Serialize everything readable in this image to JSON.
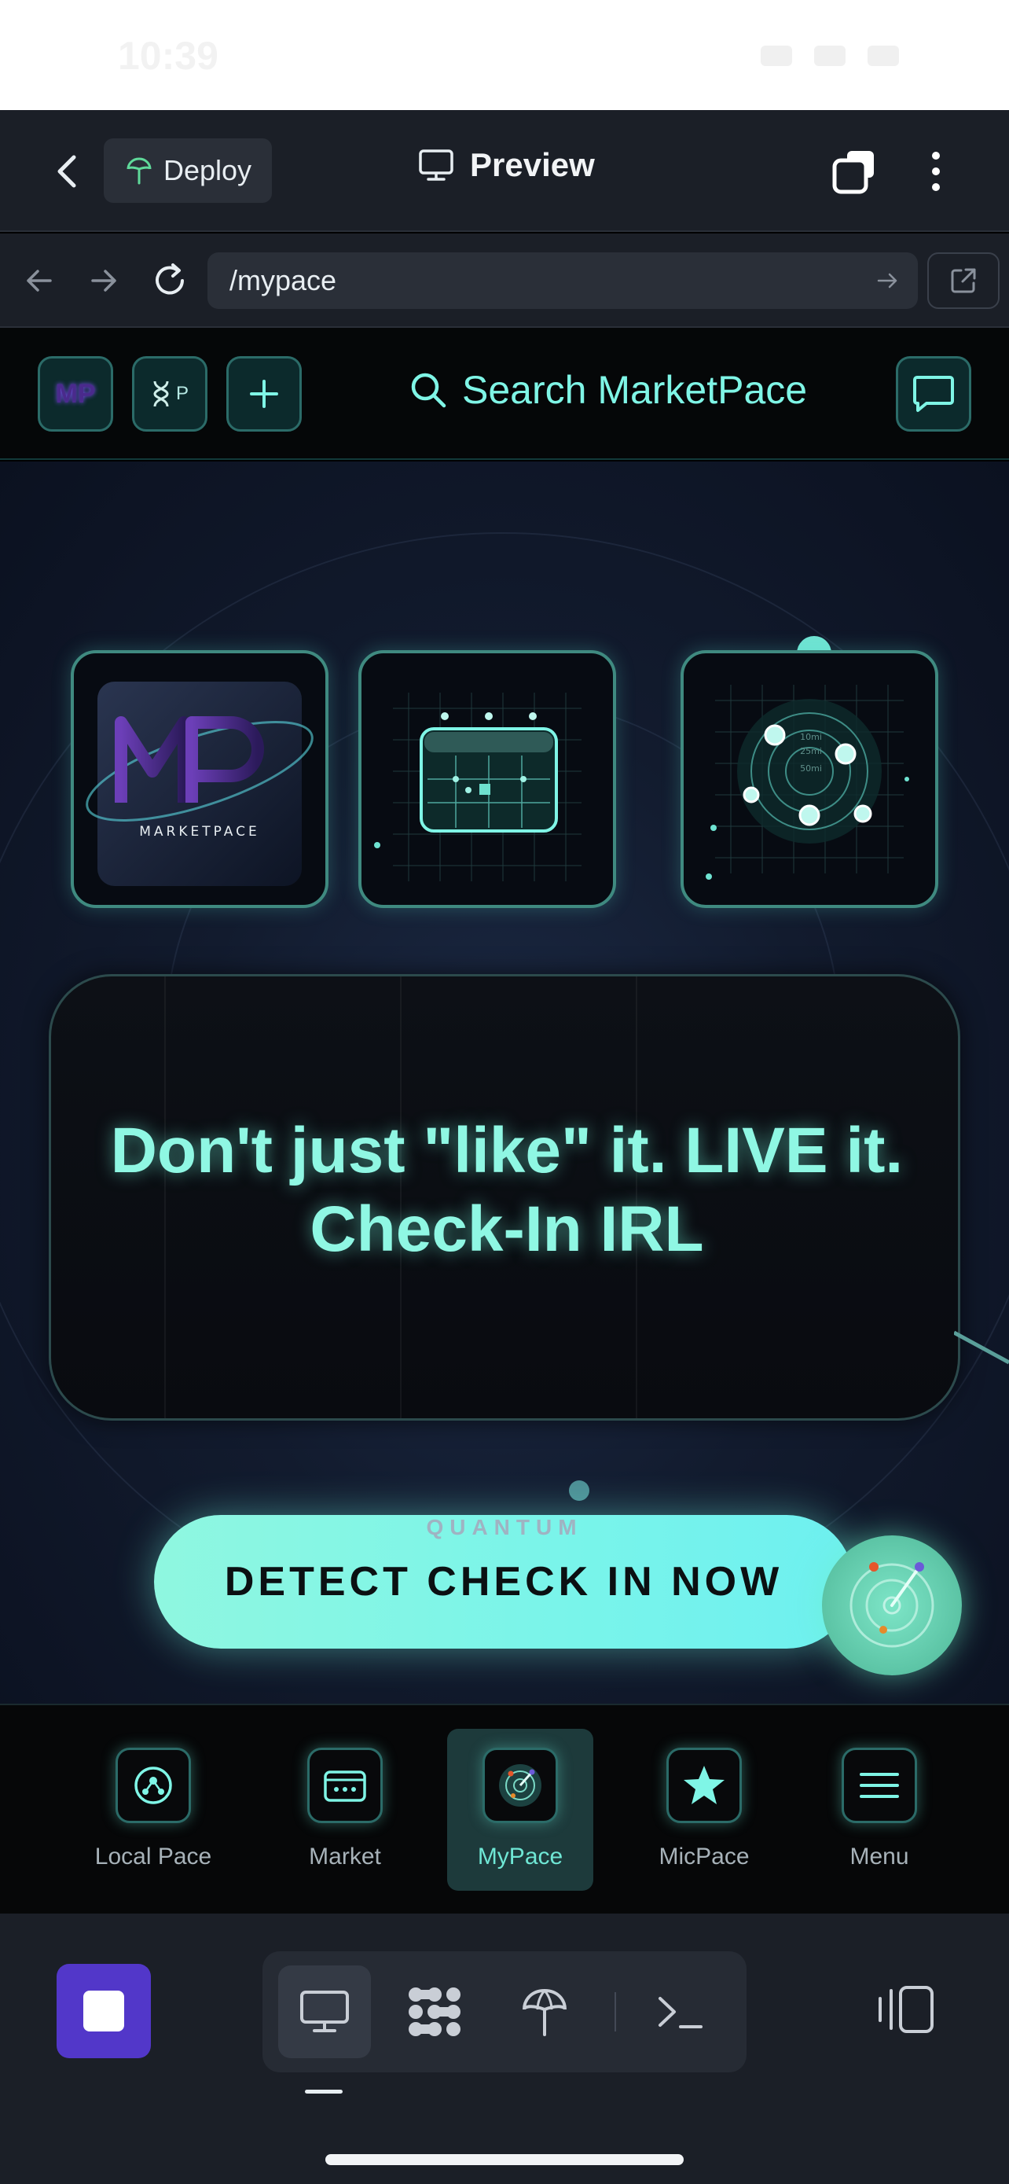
{
  "status_bar": {
    "time": "10:39"
  },
  "topbar": {
    "deploy_label": "Deploy",
    "title": "Preview"
  },
  "url_bar": {
    "path": "/mypace"
  },
  "app_header": {
    "logo_text": "MP",
    "second_badge_text": "P",
    "search_label": "Search MarketPace"
  },
  "hero": {
    "logo_tile_text": "MARKETPACE",
    "radar_labels": [
      "10mi",
      "25mi",
      "50mi"
    ],
    "tagline": "Don't just \"like\" it. LIVE it. Check-In IRL",
    "cta_kicker": "QUANTUM",
    "cta_label": "DETECT CHECK IN NOW"
  },
  "app_nav": {
    "items": [
      {
        "label": "Local Pace",
        "icon": "community-icon",
        "active": false
      },
      {
        "label": "Market",
        "icon": "store-icon",
        "active": false
      },
      {
        "label": "MyPace",
        "icon": "radar-icon",
        "active": true
      },
      {
        "label": "MicPace",
        "icon": "star-icon",
        "active": false
      },
      {
        "label": "Menu",
        "icon": "hamburger-icon",
        "active": false
      }
    ]
  },
  "colors": {
    "accent": "#7ff5e6",
    "active_bg": "#1d3a3b",
    "stop_button": "#5237c9",
    "toolbar_bg": "#1b1f27"
  }
}
